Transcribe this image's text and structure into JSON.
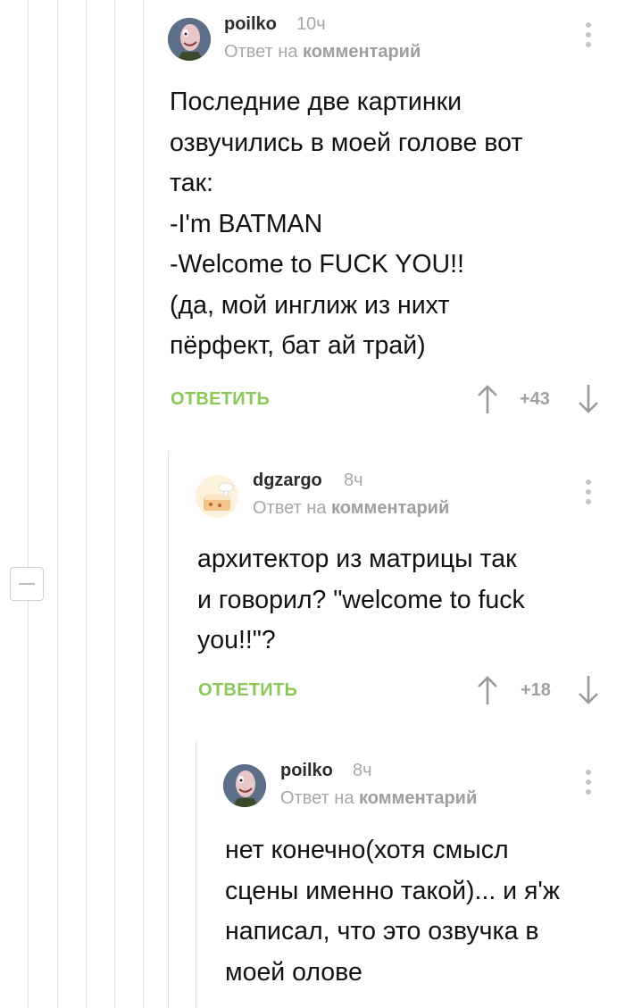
{
  "comments": [
    {
      "username": "poilko",
      "time": "10ч",
      "reply_prefix": "Ответ на",
      "reply_target": "комментарий",
      "text": "Последние две картинки\nозвучились в моей голове вот\nтак:\n-I'm BATMAN\n-Welcome to FUCK YOU!!\n(да, мой инглиж из нихт\nпёрфект, бат ай трай)",
      "reply_label": "ОТВЕТИТЬ",
      "score": "+43",
      "avatar_icon": "cartoon-face-avatar-icon"
    },
    {
      "username": "dgzargo",
      "time": "8ч",
      "reply_prefix": "Ответ на",
      "reply_target": "комментарий",
      "text": "архитектор из матрицы так\nи говорил? \"welcome to fuck\nyou!!\"?",
      "reply_label": "ОТВЕТИТЬ",
      "score": "+18",
      "avatar_icon": "cartoon-cake-avatar-icon"
    },
    {
      "username": "poilko",
      "time": "8ч",
      "reply_prefix": "Ответ на",
      "reply_target": "комментарий",
      "text": "нет конечно(хотя смысл\nсцены именно такой)... и я'ж\nнаписал, что это озвучка в\nмоей олове",
      "avatar_icon": "cartoon-face-avatar-icon"
    }
  ],
  "colors": {
    "accent_green": "#8ac858",
    "muted_gray": "#a7a7a7",
    "thread_line": "#e1e1e1"
  }
}
